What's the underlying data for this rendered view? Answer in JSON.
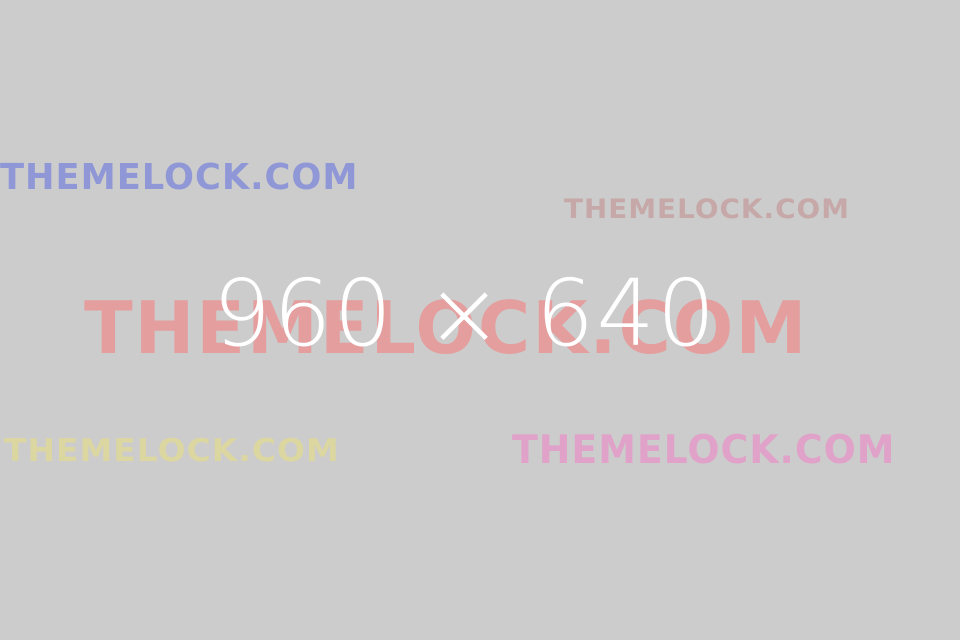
{
  "placeholder": {
    "dimensions_label": "960 × 640",
    "background_color": "#cccccc",
    "text_color": "#ffffff"
  },
  "watermarks": [
    {
      "text": "THEMELOCK.COM",
      "color": "#8f97d6"
    },
    {
      "text": "THEMELOCK.COM",
      "color": "#c6a8a8"
    },
    {
      "text": "THEMELOCK.COM",
      "color": "#e59e9e"
    },
    {
      "text": "THEMELOCK.COM",
      "color": "#dcd6a0"
    },
    {
      "text": "THEMELOCK.COM",
      "color": "#e0a2c8"
    }
  ]
}
